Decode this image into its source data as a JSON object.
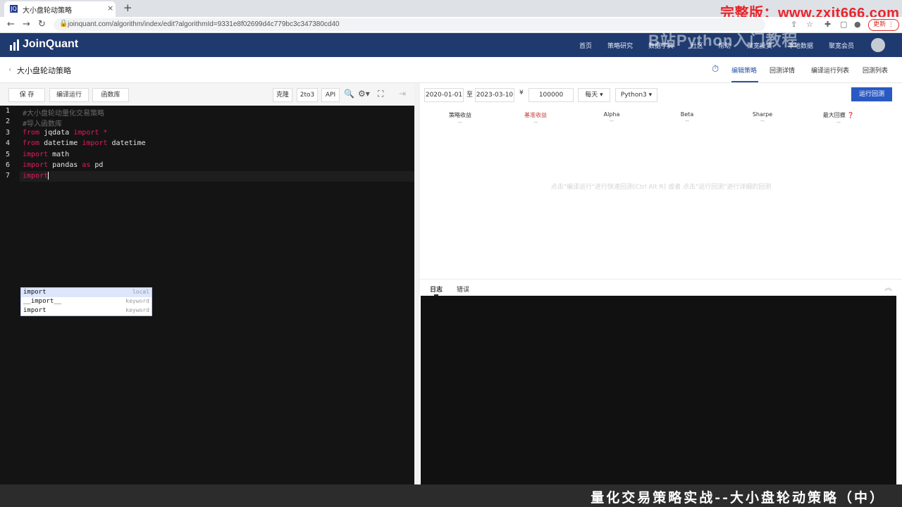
{
  "browser": {
    "tab_title": "大小盘轮动策略",
    "tab_favicon": "JQ",
    "close": "×",
    "new_tab": "+",
    "url": "joinquant.com/algorithm/index/edit?algorithmId=9331e8f02699d4c779bc3c347380cd40",
    "update_label": "更新 ⋮",
    "watermark": "完整版：www.zxit666.com"
  },
  "site": {
    "logo": "JoinQuant",
    "nav": [
      "首页",
      "策略研究",
      "数据字典",
      "社区",
      "帮助",
      "聚宽投资",
      "本地数据",
      "聚宽会员"
    ],
    "watermark_overlay": "B站Python入门教程"
  },
  "subheader": {
    "back": "‹",
    "title": "大小盘轮动策略",
    "tabs": [
      "编辑策略",
      "回测详情",
      "编译运行列表",
      "回测列表"
    ]
  },
  "toolbar": {
    "save": "保 存",
    "compile_run": "编译运行",
    "function_lib": "函数库",
    "clone": "克隆",
    "to3": "2to3",
    "api": "API"
  },
  "editor": {
    "lines": [
      {
        "no": "1",
        "parts": [
          {
            "t": "#大小盘轮动量化交易策略",
            "c": "cm"
          }
        ]
      },
      {
        "no": "2",
        "parts": [
          {
            "t": "#导入函数库",
            "c": "cm"
          }
        ]
      },
      {
        "no": "3",
        "parts": [
          {
            "t": "from",
            "c": "kw"
          },
          {
            "t": " jqdata ",
            "c": ""
          },
          {
            "t": "import",
            "c": "kw"
          },
          {
            "t": " *",
            "c": "kw"
          }
        ]
      },
      {
        "no": "4",
        "parts": [
          {
            "t": "from",
            "c": "kw"
          },
          {
            "t": " datetime ",
            "c": ""
          },
          {
            "t": "import",
            "c": "kw"
          },
          {
            "t": " datetime",
            "c": ""
          }
        ]
      },
      {
        "no": "5",
        "parts": [
          {
            "t": "import",
            "c": "kw"
          },
          {
            "t": " math",
            "c": ""
          }
        ]
      },
      {
        "no": "6",
        "parts": [
          {
            "t": "import",
            "c": "kw"
          },
          {
            "t": " pandas ",
            "c": ""
          },
          {
            "t": "as",
            "c": "kw"
          },
          {
            "t": " pd",
            "c": ""
          }
        ]
      },
      {
        "no": "7",
        "parts": [
          {
            "t": "import",
            "c": "kw"
          }
        ]
      }
    ],
    "autocomplete": [
      {
        "label": "import",
        "kind": "local"
      },
      {
        "label": "__import__",
        "kind": "keyword"
      },
      {
        "label": "import",
        "kind": "keyword"
      }
    ]
  },
  "params": {
    "start_date": "2020-01-01",
    "to": "至",
    "end_date": "2023-03-10",
    "currency": "¥",
    "capital": "100000",
    "frequency": "每天 ▾",
    "python": "Python3 ▾",
    "run_backtest": "运行回测"
  },
  "metrics": [
    {
      "label": "策略收益",
      "value": "--"
    },
    {
      "label": "基准收益",
      "value": "--"
    },
    {
      "label": "Alpha",
      "value": "--"
    },
    {
      "label": "Beta",
      "value": "--"
    },
    {
      "label": "Sharpe",
      "value": "--"
    },
    {
      "label": "最大回撤 ❓",
      "value": "--"
    }
  ],
  "placeholder": "点击\"编译运行\"进行快速回测(Ctrl Alt R) 或者 点击\"运行回测\"进行详细的回测",
  "log": {
    "tabs": [
      "日志",
      "错误"
    ],
    "collapse": "︽"
  },
  "subtitle": "量化交易策略实战--大小盘轮动策略（中）",
  "colors": {
    "header_bg": "#1f3a6e",
    "accent": "#2b55a5",
    "keyword": "#e6195f",
    "editor_bg": "#141414"
  }
}
